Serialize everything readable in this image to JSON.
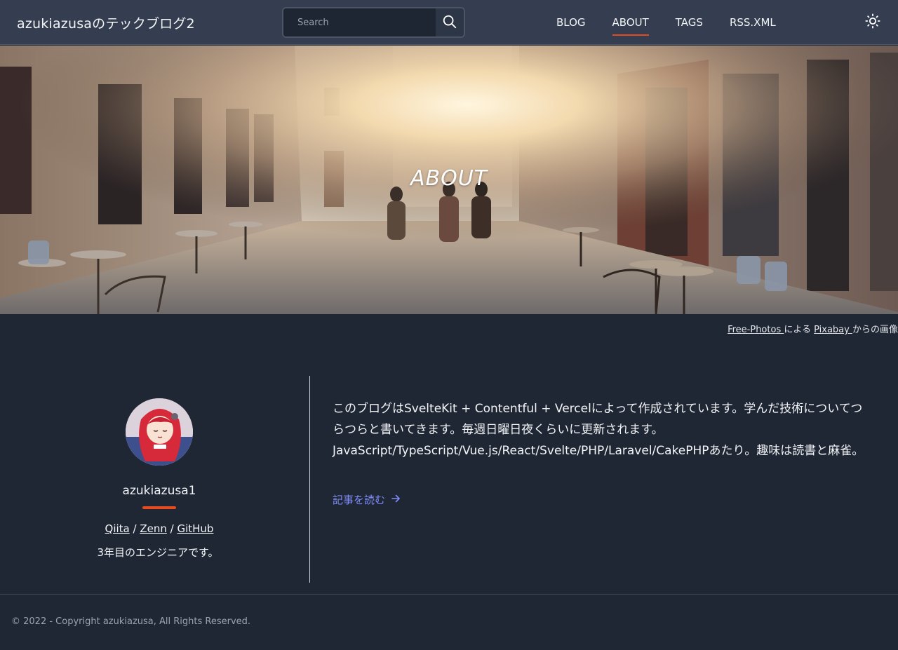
{
  "header": {
    "site_title": "azukiazusaのテックブログ2",
    "search": {
      "placeholder": "Search",
      "value": ""
    },
    "nav": [
      {
        "label": "BLOG",
        "active": false
      },
      {
        "label": "ABOUT",
        "active": true
      },
      {
        "label": "TAGS",
        "active": false
      },
      {
        "label": "RSS.XML",
        "active": false
      }
    ],
    "icons": {
      "search": "search-icon",
      "theme": "sun-icon"
    }
  },
  "hero": {
    "title": "ABOUT"
  },
  "credit": {
    "author_link": "Free-Photos ",
    "by_text": "による ",
    "site_link": "Pixabay ",
    "suffix": "からの画像"
  },
  "profile": {
    "username": "azukiazusa1",
    "links": [
      {
        "label": "Qiita"
      },
      {
        "label": "Zenn"
      },
      {
        "label": "GitHub"
      }
    ],
    "separator": " / ",
    "bio": "3年目のエンジニアです。"
  },
  "about": {
    "description": "このブログはSvelteKit + Contentful + Vercelによって作成されています。学んだ技術についてつらつらと書いてきます。毎週日曜日夜くらいに更新されます。JavaScript/TypeScript/Vue.js/React/Svelte/PHP/Laravel/CakePHPあたり。趣味は読書と麻雀。",
    "read_more": "記事を読む"
  },
  "footer": {
    "copyright": "© 2022 - Copyright azukiazusa, All Rights Reserved."
  },
  "colors": {
    "background": "#1f2735",
    "header": "#343e50",
    "accent": "#e8491d",
    "link": "#818cf8"
  }
}
